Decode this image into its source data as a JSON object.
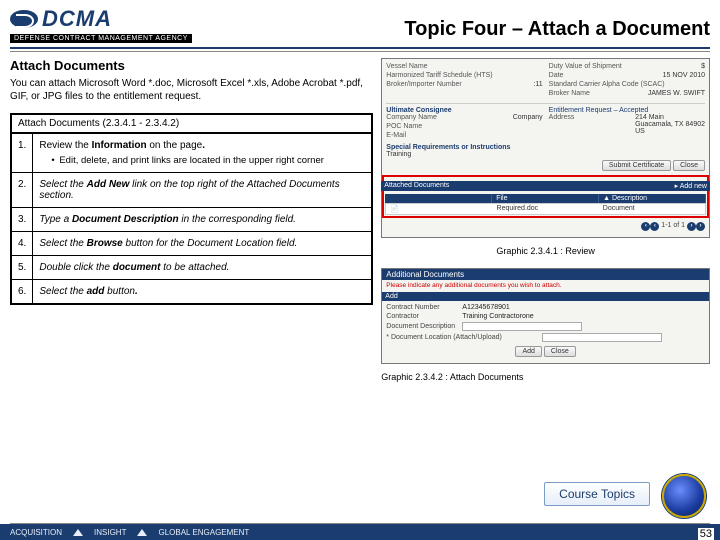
{
  "header": {
    "logo": "DCMA",
    "logo_sub": "DEFENSE CONTRACT MANAGEMENT AGENCY",
    "topic_title": "Topic Four – Attach a Document"
  },
  "section": {
    "title": "Attach Documents",
    "intro": "You can attach Microsoft Word *.doc, Microsoft Excel *.xls, Adobe Acrobat *.pdf, GIF, or JPG files to the entitlement request."
  },
  "steps": {
    "header": "Attach Documents (2.3.4.1 - 2.3.4.2)",
    "rows": [
      {
        "n": "1.",
        "html": "Review the <b>Information</b> on the page<b>.</b>",
        "sub": "Edit, delete, and print links are located in the upper right corner"
      },
      {
        "n": "2.",
        "html": "Select the <b>Add New</b> link on the top right of the Attached Documents section."
      },
      {
        "n": "3.",
        "html": "Type a <b>Document Description</b> in the corresponding field."
      },
      {
        "n": "4.",
        "html": "Select the <b>Browse</b> button for the Document Location field."
      },
      {
        "n": "5.",
        "html": "Double click the <b>document</b> to be attached."
      },
      {
        "n": "6.",
        "html": "Select the <b>add</b> button<b>.</b>"
      }
    ]
  },
  "screenshot1": {
    "labels": {
      "vessel": "Vessel Name",
      "hts": "Harmonized Tariff Schedule (HTS)",
      "broker": "Broker/Importer Number",
      "broker_val": ":11",
      "date": "Date",
      "date_val": "15 NOV 2010",
      "scac": "Standard Carrier Alpha Code (SCAC)",
      "bname": "Broker Name",
      "bname_val": "JAMES W. SWIFT",
      "duty": "Duty Value of Shipment"
    },
    "consignee": {
      "h": "Ultimate Consignee",
      "company": "Company Name",
      "company_v": "Company",
      "poc": "POC Name",
      "addr": "Address",
      "addr_v1": "214 Main",
      "addr_v2": "Guacamala, TX 84902",
      "addr_v3": "US",
      "email": "E-Mail"
    },
    "ent": "Entitlement Request – Accepted",
    "special": "Special Requirements or Instructions",
    "special_v": "Training",
    "btn_submit": "Submit Certificate",
    "btn_close": "Close",
    "att_hdr": "Attached Documents",
    "col_file": "File",
    "col_desc": "▲ Description",
    "addnew": "Add new",
    "row_file": "Required.doc",
    "row_desc": "Document",
    "pager": "1-1 of 1",
    "caption": "Graphic 2.3.4.1 : Review"
  },
  "screenshot2": {
    "title": "Additional Documents",
    "info": "Please indicate any additional documents you wish to attach.",
    "add_hdr": "Add",
    "contract": "Contract Number",
    "contract_v": "A12345678901",
    "contractor": "Contractor",
    "contractor_v": "Training Contractorone",
    "desc": "Document Description",
    "loc": "* Document Location (Attach/Upload)",
    "btn_add": "Add",
    "btn_close": "Close",
    "caption": "Graphic 2.3.4.2 : Attach Documents"
  },
  "course_topics": "Course Topics",
  "footer": {
    "a": "ACQUISITION",
    "b": "INSIGHT",
    "c": "GLOBAL ENGAGEMENT",
    "page": "53"
  }
}
